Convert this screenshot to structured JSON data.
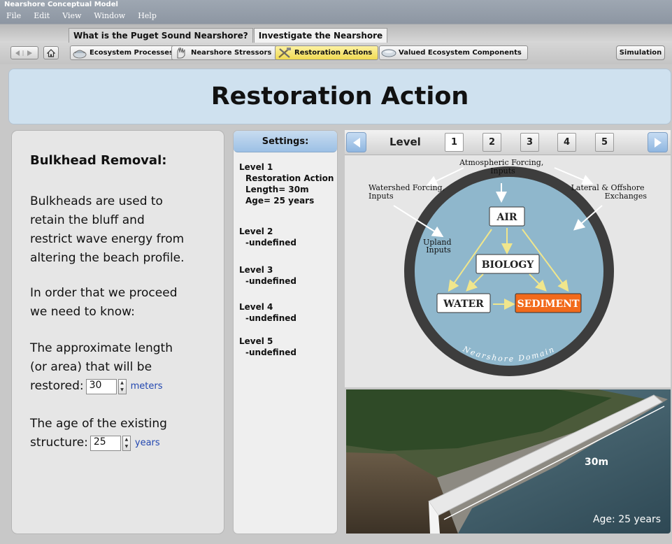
{
  "window": {
    "title": "Nearshore Conceptual Model"
  },
  "menu": [
    "File",
    "Edit",
    "View",
    "Window",
    "Help"
  ],
  "main_tabs": [
    {
      "label": "What is the Puget Sound Nearshore?",
      "active": false
    },
    {
      "label": "Investigate the Nearshore",
      "active": true
    }
  ],
  "toolbar": {
    "back_icon": "back-forward-arrows-icon",
    "home_icon": "home-icon",
    "sub_tabs": [
      {
        "label": "Ecosystem Processes",
        "icon": "ecosystem-icon",
        "active": false
      },
      {
        "label": "Nearshore Stressors",
        "icon": "stressors-hand-icon",
        "active": false
      },
      {
        "label": "Restoration Actions",
        "icon": "tools-icon",
        "active": true
      },
      {
        "label": "Valued Ecosystem Components",
        "icon": "vec-icon",
        "active": false
      }
    ],
    "simulation_label": "Simulation"
  },
  "page": {
    "heading": "Restoration Action"
  },
  "left_panel": {
    "title": "Bulkhead Removal:",
    "desc_lines": [
      "Bulkheads are used to",
      "retain the bluff and",
      "restrict wave energy from",
      "altering the beach profile."
    ],
    "proceed_lines": [
      "In order that we proceed",
      "we need to know:"
    ],
    "length_lines": [
      "The approximate length",
      "(or area) that will be"
    ],
    "length_prompt": "restored:",
    "length_value": "30",
    "length_unit": "meters",
    "age_line": "The age of the existing",
    "age_prompt": "structure:",
    "age_value": "25",
    "age_unit": "years"
  },
  "settings": {
    "header": "Settings:",
    "levels": [
      {
        "title": "Level 1",
        "lines": [
          "Restoration Action",
          "Length= 30m",
          "Age= 25 years"
        ]
      },
      {
        "title": "Level 2",
        "lines": [
          "-undefined"
        ]
      },
      {
        "title": "Level 3",
        "lines": [
          "-undefined"
        ]
      },
      {
        "title": "Level 4",
        "lines": [
          "-undefined"
        ]
      },
      {
        "title": "Level 5",
        "lines": [
          "-undefined"
        ]
      }
    ]
  },
  "level_nav": {
    "label": "Level",
    "levels": [
      "1",
      "2",
      "3",
      "4",
      "5"
    ],
    "active": "1"
  },
  "diagram": {
    "external": {
      "atmospheric": [
        "Atmospheric Forcing,",
        "Inputs"
      ],
      "watershed": [
        "Watershed Forcing,",
        "Inputs"
      ],
      "lateral": [
        "Lateral & Offshore",
        "Exchanges"
      ],
      "upland": [
        "Upland",
        "Inputs"
      ]
    },
    "nodes": {
      "air": "AIR",
      "biology": "BIOLOGY",
      "water": "WATER",
      "sediment": "SEDIMENT"
    },
    "ring_label": "Nearshore Domain",
    "colors": {
      "ring": "#3d3d3d",
      "inner": "#8fb7cc",
      "arrow": "#f0e68c",
      "sediment": "#f26a1b"
    }
  },
  "photo": {
    "length_label": "30m",
    "age_label": "Age: 25 years"
  }
}
